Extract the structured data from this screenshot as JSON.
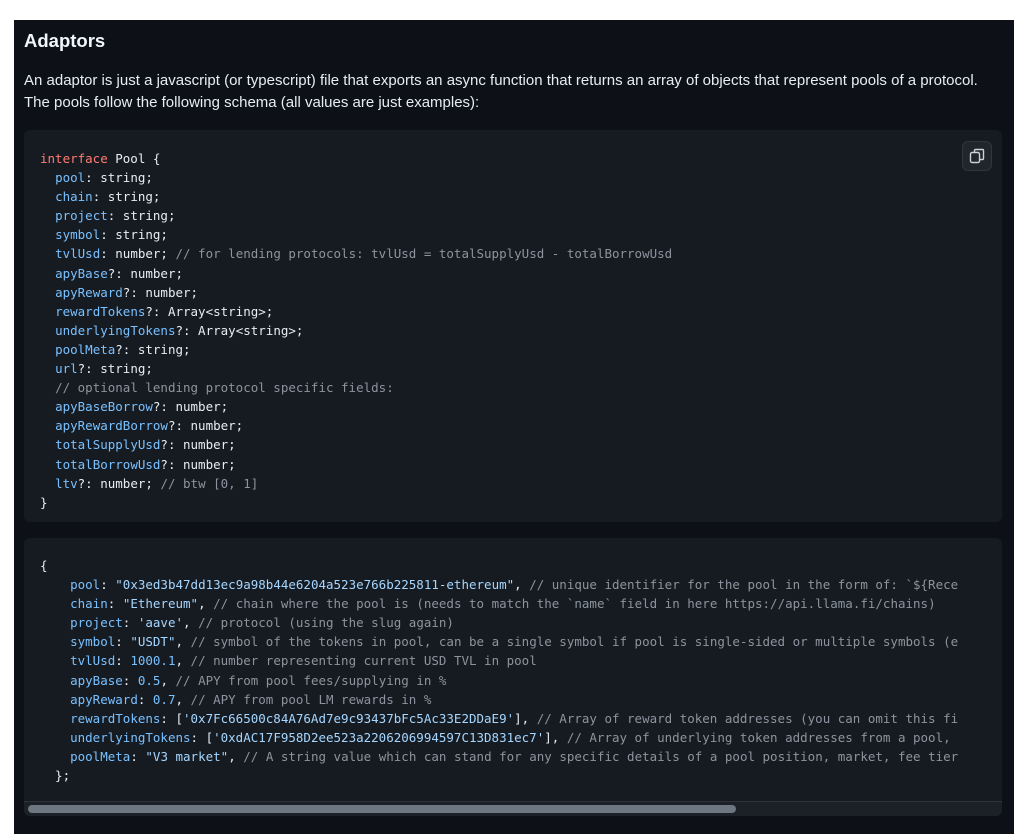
{
  "section": {
    "title": "Adaptors",
    "description": "An adaptor is just a javascript (or typescript) file that exports an async function that returns an array of objects that represent pools of a protocol. The pools follow the following schema (all values are just examples):"
  },
  "icons": {
    "copy": "copy-icon"
  },
  "code_block_1": {
    "lines": [
      [
        {
          "t": "interface",
          "c": "kw"
        },
        {
          "t": " Pool {",
          "c": ""
        }
      ],
      [
        {
          "t": "  ",
          "c": ""
        },
        {
          "t": "pool",
          "c": "prop"
        },
        {
          "t": ": string;",
          "c": ""
        }
      ],
      [
        {
          "t": "  ",
          "c": ""
        },
        {
          "t": "chain",
          "c": "prop"
        },
        {
          "t": ": string;",
          "c": ""
        }
      ],
      [
        {
          "t": "  ",
          "c": ""
        },
        {
          "t": "project",
          "c": "prop"
        },
        {
          "t": ": string;",
          "c": ""
        }
      ],
      [
        {
          "t": "  ",
          "c": ""
        },
        {
          "t": "symbol",
          "c": "prop"
        },
        {
          "t": ": string;",
          "c": ""
        }
      ],
      [
        {
          "t": "  ",
          "c": ""
        },
        {
          "t": "tvlUsd",
          "c": "prop"
        },
        {
          "t": ": number; ",
          "c": ""
        },
        {
          "t": "// for lending protocols: tvlUsd = totalSupplyUsd - totalBorrowUsd",
          "c": "cm"
        }
      ],
      [
        {
          "t": "  ",
          "c": ""
        },
        {
          "t": "apyBase",
          "c": "prop"
        },
        {
          "t": "?: number;",
          "c": ""
        }
      ],
      [
        {
          "t": "  ",
          "c": ""
        },
        {
          "t": "apyReward",
          "c": "prop"
        },
        {
          "t": "?: number;",
          "c": ""
        }
      ],
      [
        {
          "t": "  ",
          "c": ""
        },
        {
          "t": "rewardTokens",
          "c": "prop"
        },
        {
          "t": "?: Array<string>;",
          "c": ""
        }
      ],
      [
        {
          "t": "  ",
          "c": ""
        },
        {
          "t": "underlyingTokens",
          "c": "prop"
        },
        {
          "t": "?: Array<string>;",
          "c": ""
        }
      ],
      [
        {
          "t": "  ",
          "c": ""
        },
        {
          "t": "poolMeta",
          "c": "prop"
        },
        {
          "t": "?: string;",
          "c": ""
        }
      ],
      [
        {
          "t": "  ",
          "c": ""
        },
        {
          "t": "url",
          "c": "prop"
        },
        {
          "t": "?: string;",
          "c": ""
        }
      ],
      [
        {
          "t": "  ",
          "c": ""
        },
        {
          "t": "// optional lending protocol specific fields:",
          "c": "cm"
        }
      ],
      [
        {
          "t": "  ",
          "c": ""
        },
        {
          "t": "apyBaseBorrow",
          "c": "prop"
        },
        {
          "t": "?: number;",
          "c": ""
        }
      ],
      [
        {
          "t": "  ",
          "c": ""
        },
        {
          "t": "apyRewardBorrow",
          "c": "prop"
        },
        {
          "t": "?: number;",
          "c": ""
        }
      ],
      [
        {
          "t": "  ",
          "c": ""
        },
        {
          "t": "totalSupplyUsd",
          "c": "prop"
        },
        {
          "t": "?: number;",
          "c": ""
        }
      ],
      [
        {
          "t": "  ",
          "c": ""
        },
        {
          "t": "totalBorrowUsd",
          "c": "prop"
        },
        {
          "t": "?: number;",
          "c": ""
        }
      ],
      [
        {
          "t": "  ",
          "c": ""
        },
        {
          "t": "ltv",
          "c": "prop"
        },
        {
          "t": "?: number; ",
          "c": ""
        },
        {
          "t": "// btw [0, 1]",
          "c": "cm"
        }
      ],
      [
        {
          "t": "}",
          "c": ""
        }
      ]
    ]
  },
  "code_block_2": {
    "lines": [
      [
        {
          "t": "{",
          "c": ""
        }
      ],
      [
        {
          "t": "    ",
          "c": ""
        },
        {
          "t": "pool",
          "c": "prop"
        },
        {
          "t": ": ",
          "c": ""
        },
        {
          "t": "\"0x3ed3b47dd13ec9a98b44e6204a523e766b225811-ethereum\"",
          "c": "str"
        },
        {
          "t": ", ",
          "c": ""
        },
        {
          "t": "// unique identifier for the pool in the form of: `${Rece",
          "c": "cm"
        }
      ],
      [
        {
          "t": "    ",
          "c": ""
        },
        {
          "t": "chain",
          "c": "prop"
        },
        {
          "t": ": ",
          "c": ""
        },
        {
          "t": "\"Ethereum\"",
          "c": "str"
        },
        {
          "t": ", ",
          "c": ""
        },
        {
          "t": "// chain where the pool is (needs to match the `name` field in here https://api.llama.fi/chains)",
          "c": "cm"
        }
      ],
      [
        {
          "t": "    ",
          "c": ""
        },
        {
          "t": "project",
          "c": "prop"
        },
        {
          "t": ": ",
          "c": ""
        },
        {
          "t": "'aave'",
          "c": "str"
        },
        {
          "t": ", ",
          "c": ""
        },
        {
          "t": "// protocol (using the slug again)",
          "c": "cm"
        }
      ],
      [
        {
          "t": "    ",
          "c": ""
        },
        {
          "t": "symbol",
          "c": "prop"
        },
        {
          "t": ": ",
          "c": ""
        },
        {
          "t": "\"USDT\"",
          "c": "str"
        },
        {
          "t": ", ",
          "c": ""
        },
        {
          "t": "// symbol of the tokens in pool, can be a single symbol if pool is single-sided or multiple symbols (e",
          "c": "cm"
        }
      ],
      [
        {
          "t": "    ",
          "c": ""
        },
        {
          "t": "tvlUsd",
          "c": "prop"
        },
        {
          "t": ": ",
          "c": ""
        },
        {
          "t": "1000.1",
          "c": "num"
        },
        {
          "t": ", ",
          "c": ""
        },
        {
          "t": "// number representing current USD TVL in pool",
          "c": "cm"
        }
      ],
      [
        {
          "t": "    ",
          "c": ""
        },
        {
          "t": "apyBase",
          "c": "prop"
        },
        {
          "t": ": ",
          "c": ""
        },
        {
          "t": "0.5",
          "c": "num"
        },
        {
          "t": ", ",
          "c": ""
        },
        {
          "t": "// APY from pool fees/supplying in %",
          "c": "cm"
        }
      ],
      [
        {
          "t": "    ",
          "c": ""
        },
        {
          "t": "apyReward",
          "c": "prop"
        },
        {
          "t": ": ",
          "c": ""
        },
        {
          "t": "0.7",
          "c": "num"
        },
        {
          "t": ", ",
          "c": ""
        },
        {
          "t": "// APY from pool LM rewards in %",
          "c": "cm"
        }
      ],
      [
        {
          "t": "    ",
          "c": ""
        },
        {
          "t": "rewardTokens",
          "c": "prop"
        },
        {
          "t": ": [",
          "c": ""
        },
        {
          "t": "'0x7Fc66500c84A76Ad7e9c93437bFc5Ac33E2DDaE9'",
          "c": "str"
        },
        {
          "t": "], ",
          "c": ""
        },
        {
          "t": "// Array of reward token addresses (you can omit this fi",
          "c": "cm"
        }
      ],
      [
        {
          "t": "    ",
          "c": ""
        },
        {
          "t": "underlyingTokens",
          "c": "prop"
        },
        {
          "t": ": [",
          "c": ""
        },
        {
          "t": "'0xdAC17F958D2ee523a2206206994597C13D831ec7'",
          "c": "str"
        },
        {
          "t": "], ",
          "c": ""
        },
        {
          "t": "// Array of underlying token addresses from a pool,",
          "c": "cm"
        }
      ],
      [
        {
          "t": "    ",
          "c": ""
        },
        {
          "t": "poolMeta",
          "c": "prop"
        },
        {
          "t": ": ",
          "c": ""
        },
        {
          "t": "\"V3 market\"",
          "c": "str"
        },
        {
          "t": ", ",
          "c": ""
        },
        {
          "t": "// A string value which can stand for any specific details of a pool position, market, fee tier",
          "c": "cm"
        }
      ],
      [
        {
          "t": "  };",
          "c": ""
        }
      ]
    ]
  },
  "scroll": {
    "horizontal_position": 0.0,
    "visible_fraction": 0.73
  }
}
